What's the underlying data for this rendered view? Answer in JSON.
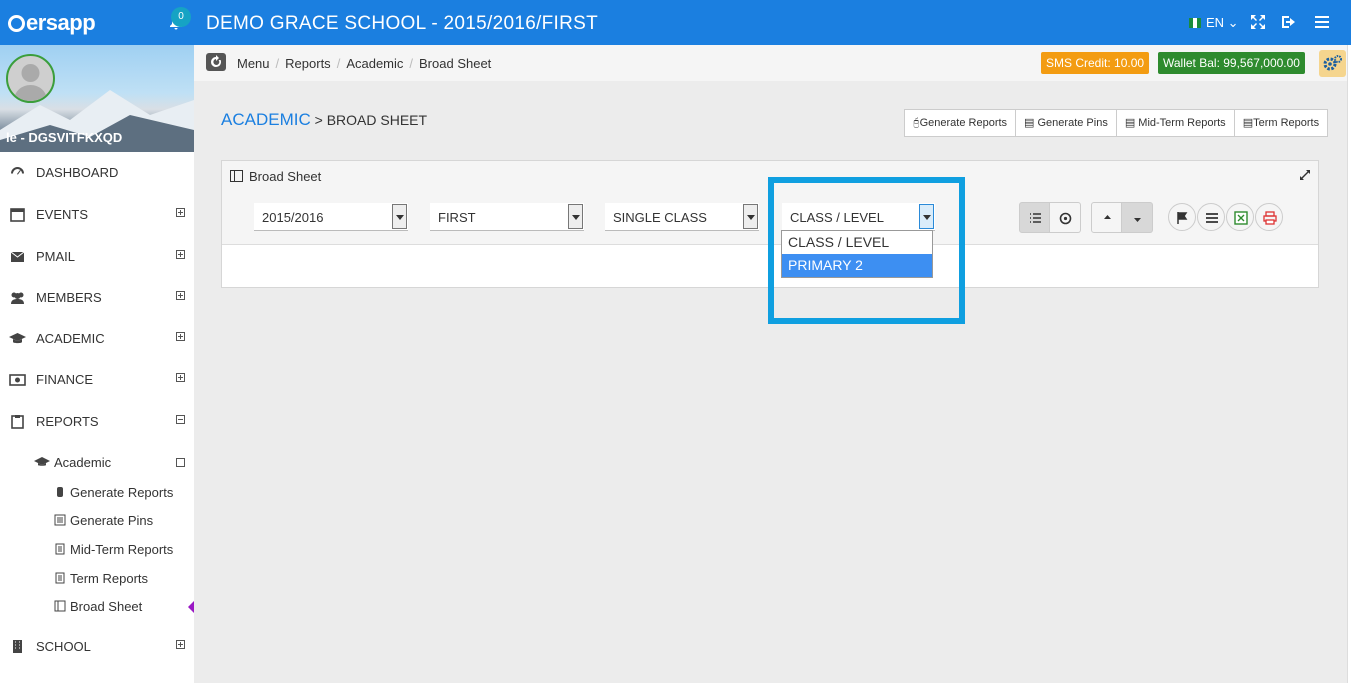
{
  "topbar": {
    "logo": "ersapp",
    "notification_count": "0",
    "app_title": "DEMO GRACE SCHOOL - 2015/2016/FIRST",
    "language": "EN"
  },
  "sidebar": {
    "profile_name": "le - DGSVITFKXQD",
    "items": [
      {
        "label": "DASHBOARD",
        "icon": "dashboard-icon"
      },
      {
        "label": "EVENTS",
        "icon": "calendar-icon"
      },
      {
        "label": "PMAIL",
        "icon": "mail-icon"
      },
      {
        "label": "MEMBERS",
        "icon": "users-icon"
      },
      {
        "label": "ACADEMIC",
        "icon": "graduation-cap-icon"
      },
      {
        "label": "FINANCE",
        "icon": "money-icon"
      },
      {
        "label": "REPORTS",
        "icon": "clipboard-icon"
      },
      {
        "label": "SCHOOL",
        "icon": "building-icon"
      }
    ],
    "sub_academic": "Academic",
    "sub_items": [
      {
        "label": "Generate Reports"
      },
      {
        "label": "Generate Pins"
      },
      {
        "label": "Mid-Term Reports"
      },
      {
        "label": "Term Reports"
      },
      {
        "label": "Broad Sheet"
      }
    ]
  },
  "breadcrumb": {
    "items": [
      "Menu",
      "Reports",
      "Academic",
      "Broad Sheet"
    ],
    "sms_credit": "SMS Credit: 10.00",
    "wallet_balance": "Wallet Bal: 99,567,000.00"
  },
  "page": {
    "heading_main": "ACADEMIC",
    "heading_rest": " > BROAD SHEET",
    "buttons": [
      "Generate Reports",
      "Generate Pins",
      "Mid-Term Reports",
      "Term Reports"
    ]
  },
  "panel": {
    "title": "Broad Sheet",
    "selects": {
      "session": "2015/2016",
      "term": "FIRST",
      "mode": "SINGLE CLASS",
      "class_level": "CLASS / LEVEL"
    },
    "dropdown_options": [
      "CLASS / LEVEL",
      "PRIMARY 2"
    ],
    "dropdown_selected_index": 1
  },
  "colors": {
    "topbar": "#1b7fe0",
    "sms": "#f39c12",
    "wallet": "#2e8b2e",
    "highlight": "#0f9fe0",
    "active_marker": "#9a18c4"
  }
}
